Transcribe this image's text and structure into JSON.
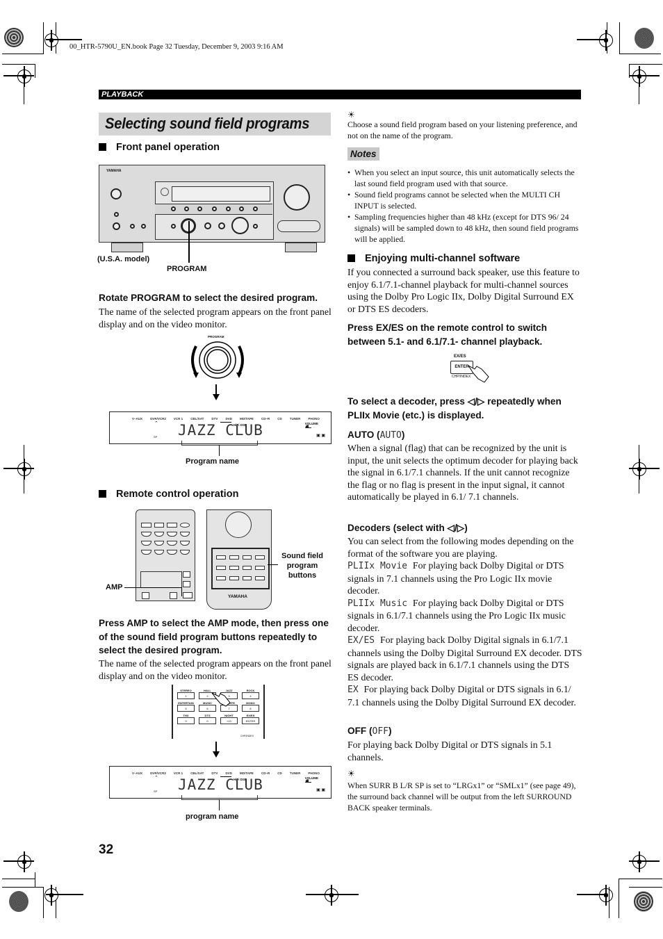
{
  "header": {
    "book_line": "00_HTR-5790U_EN.book  Page 32  Tuesday, December 9, 2003  9:16 AM",
    "section": "PLAYBACK"
  },
  "title": "Selecting sound field programs",
  "left": {
    "front_panel": {
      "heading": "Front panel operation",
      "receiver_brand": "YAMAHA",
      "model_label": "(U.S.A. model)",
      "program_label": "PROGRAM",
      "instruction": "Rotate PROGRAM to select the desired program.",
      "description": "The name of the selected program appears on the front panel display and on the video monitor.",
      "knob_label": "PROGRAM",
      "display": {
        "sources": [
          "V–AUX",
          "DVR/VCR2",
          "VCR 1",
          "CBL/SAT",
          "DTV",
          "DVD",
          "MD/TAPE",
          "CD–R",
          "CD",
          "TUNER",
          "PHONO"
        ],
        "selected_source": "DVD",
        "hifi_label": "HiFi DSP",
        "volume_label": "VOLUME",
        "program_text": "JAZZ CLUB",
        "sp_label": "SP"
      },
      "display_caption": "Program name"
    },
    "remote": {
      "heading": "Remote control operation",
      "amp_label": "AMP",
      "sound_field_label": "Sound field program buttons",
      "brand": "YAMAHA",
      "instruction": "Press AMP to select the AMP mode, then press one of the sound field program buttons repeatedly to select the desired program.",
      "description": "The name of the selected program appears on the front panel display and on the video monitor.",
      "buttons": [
        {
          "label": "STEREO",
          "key": "1"
        },
        {
          "label": "HALL",
          "key": "2"
        },
        {
          "label": "JAZZ",
          "key": "3"
        },
        {
          "label": "ROCK",
          "key": "4"
        },
        {
          "label": "ENTERTAIN",
          "key": "5"
        },
        {
          "label": "MUSIC",
          "key": "6"
        },
        {
          "label": "TV THTR",
          "key": "7"
        },
        {
          "label": "MONO",
          "key": "8"
        },
        {
          "label": "THX",
          "key": "9"
        },
        {
          "label": "DTS",
          "key": "0"
        },
        {
          "label": "NIGHT",
          "key": "+10"
        },
        {
          "label": "EX/ES",
          "key": "ENTER"
        }
      ],
      "enter_sub": "CHP/INDEX",
      "display": {
        "sources": [
          "V–AUX",
          "DVR/VCR2",
          "VCR 1",
          "CBL/SAT",
          "DTV",
          "DVD",
          "MD/TAPE",
          "CD–R",
          "CD",
          "TUNER",
          "PHONO"
        ],
        "selected_source": "DVD",
        "hifi_label": "HiFi DSP",
        "volume_label": "VOLUME",
        "program_text": "JAZZ CLUB",
        "sp_label": "SP"
      },
      "display_caption": "program name"
    }
  },
  "right": {
    "hint1": "Choose a sound field program based on your listening preference, and not on the name of the program.",
    "notes_title": "Notes",
    "notes": [
      "When you select an input source, this unit automatically selects the last sound field program used with that source.",
      "Sound field programs cannot be selected when the MULTI CH INPUT is selected.",
      "Sampling frequencies higher than 48 kHz (except for DTS 96/ 24 signals) will be sampled down to 48 kHz, then sound field programs will be applied."
    ],
    "multi_heading": "Enjoying multi-channel software",
    "multi_body": "If you connected a surround back speaker, use this feature to enjoy 6.1/7.1-channel playback for multi-channel sources using the Dolby Pro Logic IIx, Dolby Digital Surround EX or DTS ES decoders.",
    "exes_instruction": "Press EX/ES on the remote control to switch between 5.1- and 6.1/7.1- channel playback.",
    "exes_button": {
      "top": "EX/ES",
      "key": "ENTER",
      "bottom": "CHP/INDEX"
    },
    "decoder_instruction": "To select a decoder, press ◁/▷ repeatedly when PLIIx Movie (etc.) is displayed.",
    "auto": {
      "heading": "AUTO (",
      "lcd": "AUTO",
      "heading_end": ")",
      "body": "When a signal (flag) that can be recognized by the unit is input, the unit selects the optimum decoder for playing back the signal in 6.1/7.1 channels. If the unit cannot recognize the flag or no flag is present in the input signal, it cannot automatically be played in 6.1/ 7.1 channels."
    },
    "decoders": {
      "heading": "Decoders (select with ◁/▷)",
      "intro": "You can select from the following modes depending on the format of the software you are playing.",
      "items": [
        {
          "lcd": "PLIIx Movie",
          "text": "For playing back Dolby Digital or DTS signals in 7.1 channels using the Pro Logic IIx movie decoder."
        },
        {
          "lcd": "PLIIx Music",
          "text": "For playing back Dolby Digital or DTS signals in 6.1/7.1 channels using the Pro Logic IIx music decoder."
        },
        {
          "lcd": "EX/ES",
          "text": "For playing back Dolby Digital signals in 6.1/7.1 channels using the Dolby Digital Surround EX decoder. DTS signals are played back in 6.1/7.1 channels using the DTS ES decoder."
        },
        {
          "lcd": "EX",
          "text": "For playing back Dolby Digital or DTS signals in 6.1/ 7.1 channels using the Dolby Digital Surround EX decoder."
        }
      ]
    },
    "off": {
      "heading": "OFF (",
      "lcd": "OFF",
      "heading_end": ")",
      "body": "For playing back Dolby Digital or DTS signals in 5.1 channels."
    },
    "hint2": "When SURR B L/R SP is set to “LRGx1” or “SMLx1” (see page 49), the surround back channel will be output from the left SURROUND BACK speaker terminals."
  },
  "footer": {
    "page_number": "32"
  }
}
